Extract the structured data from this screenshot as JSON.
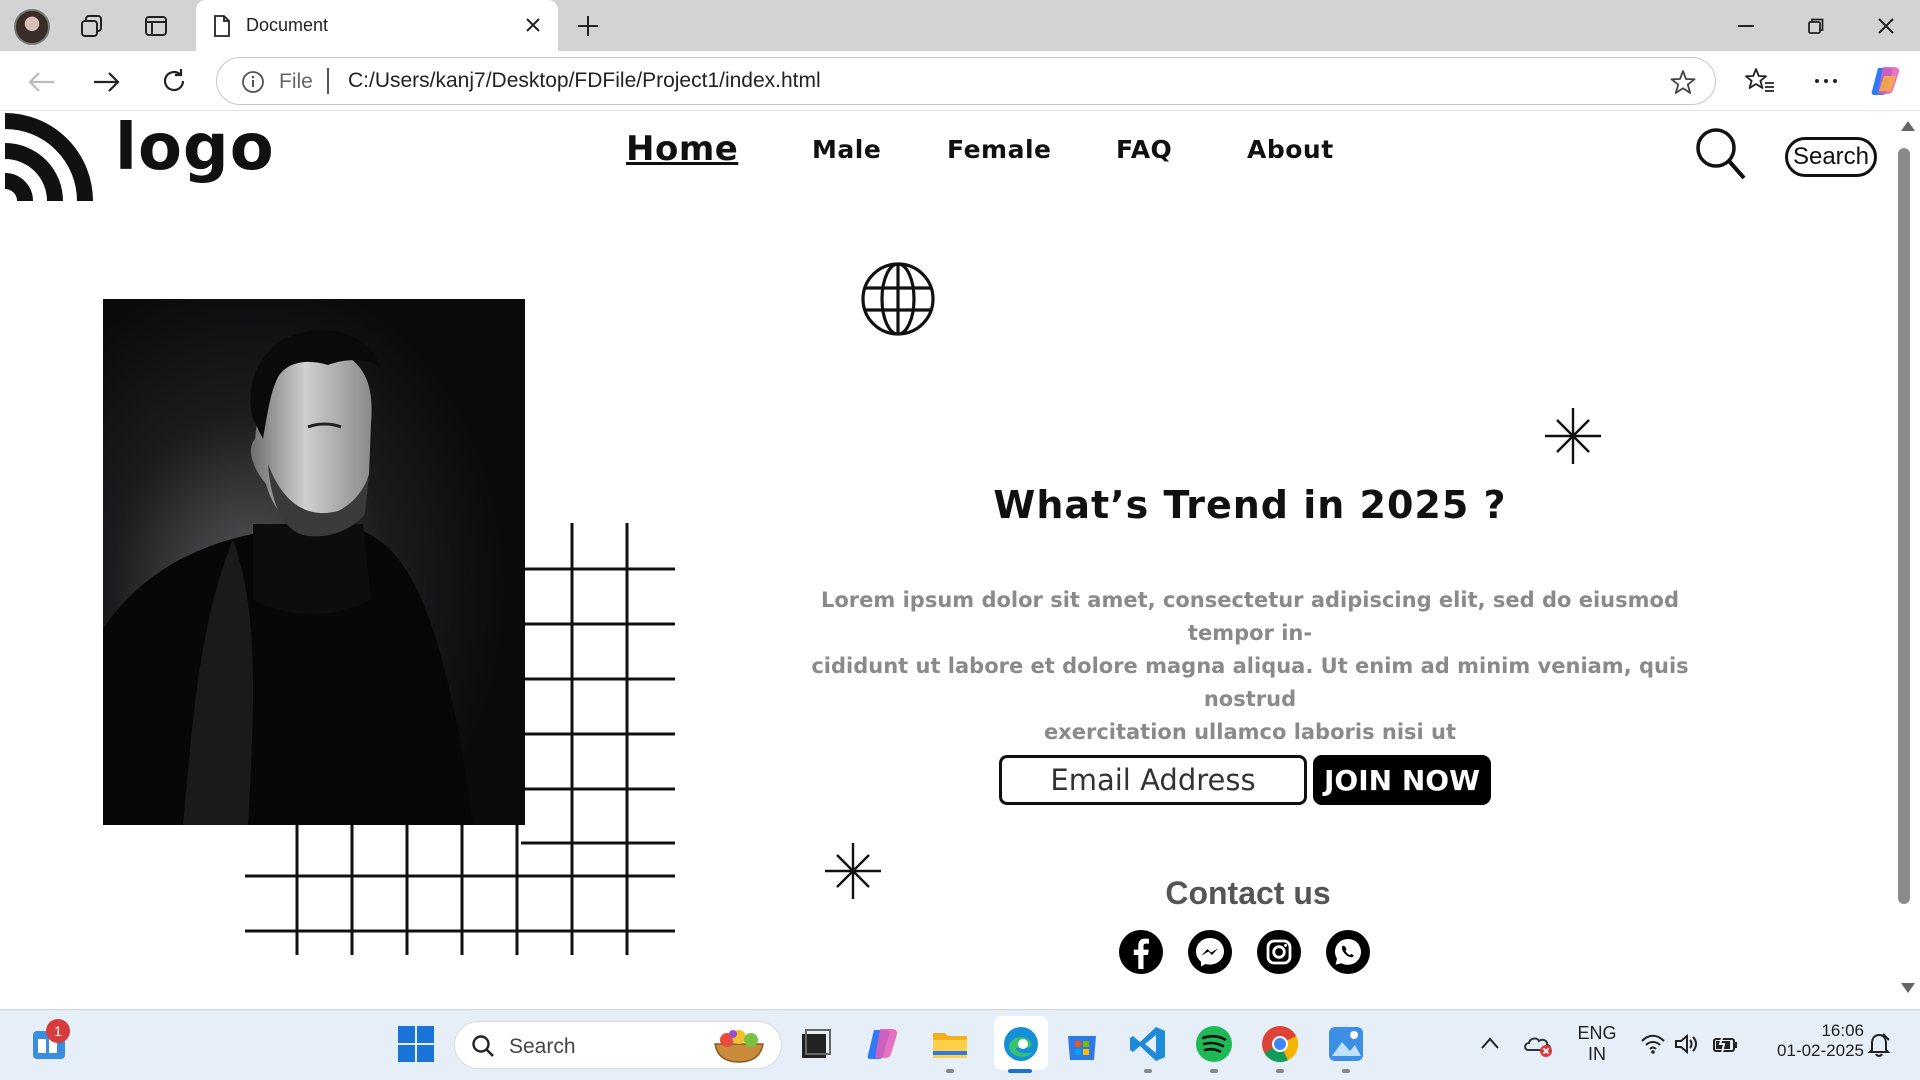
{
  "browser": {
    "tab_title": "Document",
    "url_scheme_label": "File",
    "url": "C:/Users/kanj7/Desktop/FDFile/Project1/index.html"
  },
  "site": {
    "logo_text": "logo",
    "nav": [
      "Home",
      "Male",
      "Female",
      "FAQ",
      "About"
    ],
    "search_label": "Search",
    "heading": "What’s Trend in 2025 ?",
    "lorem_lines": [
      "Lorem ipsum dolor sit amet, consectetur adipiscing elit, sed do eiusmod tempor in-",
      "cididunt ut labore et dolore magna aliqua. Ut enim ad minim veniam, quis nostrud",
      "exercitation ullamco laboris nisi ut"
    ],
    "email_placeholder": "Email Address",
    "join_label": "JOIN NOW",
    "contact_title": "Contact us",
    "social_icons": [
      "facebook-icon",
      "messenger-icon",
      "instagram-icon",
      "whatsapp-icon"
    ]
  },
  "taskbar": {
    "search_placeholder": "Search",
    "notification_count": "1",
    "lang_line1": "ENG",
    "lang_line2": "IN",
    "time": "16:06",
    "date": "01-02-2025"
  },
  "colors": {
    "accent": "#000000",
    "muted_text": "#8a8a8a",
    "contact_text": "#555555",
    "chrome_bg": "#d3d3d3",
    "taskbar_bg": "#e6eef7"
  }
}
